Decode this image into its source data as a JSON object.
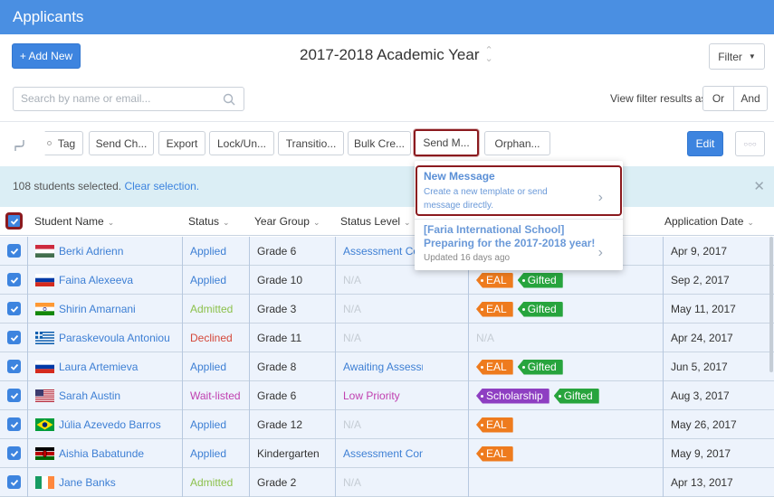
{
  "header": {
    "title": "Applicants"
  },
  "toolbar": {
    "add_new": "+ Add New",
    "year": "2017-2018 Academic Year",
    "filter": "Filter"
  },
  "search": {
    "placeholder": "Search by name or email..."
  },
  "view_filter": {
    "label": "View filter results as:",
    "or": "Or",
    "and": "And"
  },
  "actions": {
    "tag": "Tag",
    "send_ch": "Send Ch...",
    "export": "Export",
    "lock": "Lock/Un...",
    "transition": "Transitio...",
    "bulk": "Bulk Cre...",
    "send_m": "Send M...",
    "orphan": "Orphan...",
    "edit": "Edit",
    "more": "○○○"
  },
  "selection": {
    "text": "108 students selected.",
    "clear": "Clear selection."
  },
  "popup": {
    "new_title": "New Message",
    "new_desc": "Create a new template or send message directly.",
    "tpl_title": "[Faria International School] Preparing for the 2017-2018 year!",
    "tpl_meta": "Updated 16 days ago"
  },
  "columns": {
    "name": "Student Name",
    "status": "Status",
    "year_group": "Year Group",
    "status_level": "Status Level",
    "app_date": "Application Date"
  },
  "colors": {
    "applied": "#3d7fd4",
    "admitted": "#8cc14c",
    "declined": "#d4483a",
    "waitlisted": "#c040b0",
    "eal": "#ee7b1e",
    "gifted": "#27a43d",
    "scholarship": "#8e3fc2",
    "level": "#3d7fd4",
    "low": "#c040b0"
  },
  "rows": [
    {
      "flag": "hungary",
      "name": "Berki Adrienn",
      "status": "Applied",
      "status_key": "applied",
      "year": "Grade 6",
      "level": "Assessment Com",
      "level_key": "level",
      "tags": [],
      "date": "Apr 9, 2017"
    },
    {
      "flag": "russia",
      "name": "Faina Alexeeva",
      "status": "Applied",
      "status_key": "applied",
      "year": "Grade 10",
      "level": "N/A",
      "level_key": "na",
      "tags": [
        "EAL",
        "Gifted"
      ],
      "date": "Sep 2, 2017"
    },
    {
      "flag": "india",
      "name": "Shirin Amarnani",
      "status": "Admitted",
      "status_key": "admitted",
      "year": "Grade 3",
      "level": "N/A",
      "level_key": "na",
      "tags": [
        "EAL",
        "Gifted"
      ],
      "date": "May 11, 2017"
    },
    {
      "flag": "greece",
      "name": "Paraskevoula Antoniou",
      "status": "Declined",
      "status_key": "declined",
      "year": "Grade 11",
      "level": "N/A",
      "level_key": "na",
      "tags": [
        "N/A"
      ],
      "date": "Apr 24, 2017"
    },
    {
      "flag": "russia",
      "name": "Laura Artemieva",
      "status": "Applied",
      "status_key": "applied",
      "year": "Grade 8",
      "level": "Awaiting Assessment",
      "level_key": "level",
      "tags": [
        "EAL",
        "Gifted"
      ],
      "date": "Jun 5, 2017"
    },
    {
      "flag": "usa",
      "name": "Sarah Austin",
      "status": "Wait-listed",
      "status_key": "waitlisted",
      "year": "Grade 6",
      "level": "Low Priority",
      "level_key": "low",
      "tags": [
        "Scholarship",
        "Gifted"
      ],
      "date": "Aug 3, 2017"
    },
    {
      "flag": "brazil",
      "name": "Júlia Azevedo Barros",
      "status": "Applied",
      "status_key": "applied",
      "year": "Grade 12",
      "level": "N/A",
      "level_key": "na",
      "tags": [
        "EAL"
      ],
      "date": "May 26, 2017"
    },
    {
      "flag": "kenya",
      "name": "Aishia Babatunde",
      "status": "Applied",
      "status_key": "applied",
      "year": "Kindergarten",
      "level": "Assessment Completed",
      "level_key": "level",
      "tags": [
        "EAL"
      ],
      "date": "May 9, 2017"
    },
    {
      "flag": "ireland",
      "name": "Jane Banks",
      "status": "Admitted",
      "status_key": "admitted",
      "year": "Grade 2",
      "level": "N/A",
      "level_key": "na",
      "tags": [],
      "date": "Apr 13, 2017"
    }
  ]
}
